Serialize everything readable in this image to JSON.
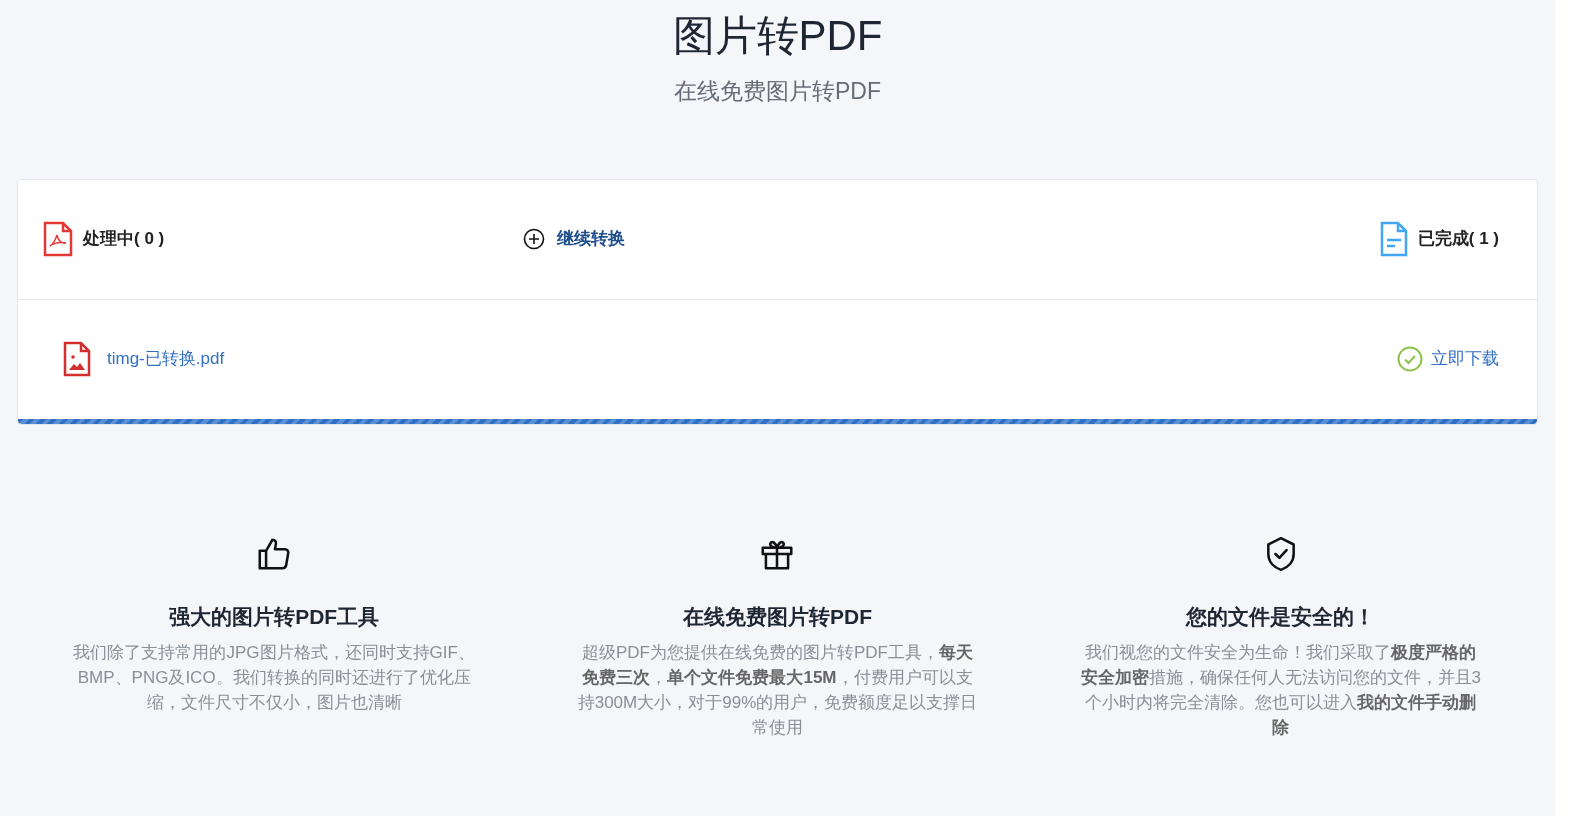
{
  "header": {
    "title": "图片转PDF",
    "subtitle": "在线免费图片转PDF"
  },
  "panel": {
    "processing": "处理中( 0 )",
    "continue": "继续转换",
    "done": "已完成( 1 )",
    "files": [
      {
        "name": "timg-已转换.pdf",
        "action": "立即下载",
        "done": true
      }
    ],
    "progress": {
      "level": 1
    }
  },
  "features": [
    {
      "kind": "thumb",
      "title": "强大的图片转PDF工具",
      "text": "我们除了支持常用的JPG图片格式，还同时支持GIF、BMP、PNG及ICO。我们转换的同时还进行了优化压缩，文件尺寸不仅小，图片也清晰"
    },
    {
      "kind": "gift",
      "title": "在线免费图片转PDF",
      "text": "超级PDF为您提供在线免费的图片转PDF工具，**每天免费三次**，**单个文件免费最大15M**，付费用户可以支持300M大小，对于99%的用户，免费额度足以支撑日常使用"
    },
    {
      "kind": "shield",
      "title": "您的文件是安全的！",
      "text": "我们视您的文件安全为生命！我们采取了**极度严格的安全加密**措施，确保任何人无法访问您的文件，并且3个小时内将完全清除。您也可以进入**我的文件手动删除**"
    }
  ]
}
